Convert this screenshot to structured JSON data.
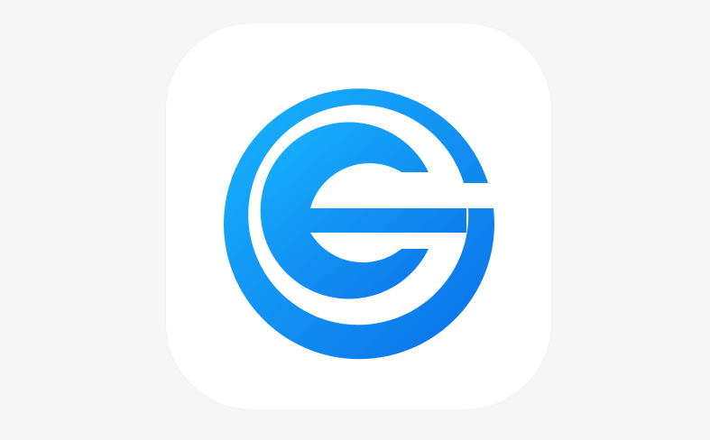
{
  "app_icon": {
    "background_color": "#ffffff",
    "logo_icon": "cg-ring-logo-icon"
  },
  "page": {
    "background_color": "#f6f6f6"
  },
  "brand": {
    "gradient_start": "#18b4ff",
    "gradient_end": "#0a6fe8"
  }
}
